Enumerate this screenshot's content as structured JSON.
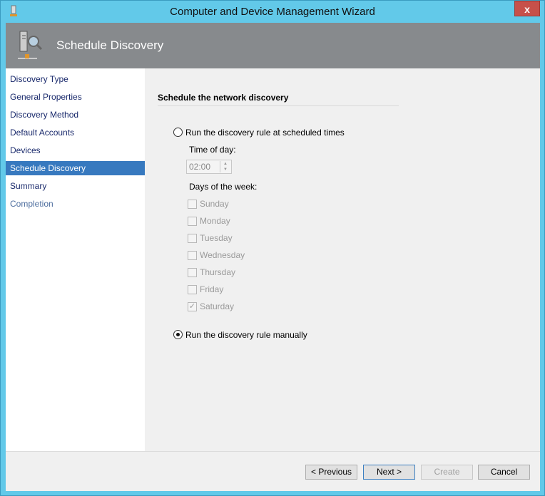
{
  "window": {
    "title": "Computer and Device Management Wizard",
    "close": "x"
  },
  "header": {
    "title": "Schedule Discovery",
    "icon": "server-search-icon"
  },
  "nav": [
    {
      "label": "Discovery Type"
    },
    {
      "label": "General Properties"
    },
    {
      "label": "Discovery Method"
    },
    {
      "label": "Default Accounts"
    },
    {
      "label": "Devices"
    },
    {
      "label": "Schedule Discovery",
      "selected": true
    },
    {
      "label": "Summary"
    },
    {
      "label": "Completion"
    }
  ],
  "main": {
    "section": "Schedule the network discovery",
    "opt_scheduled": "Run the discovery rule at scheduled times",
    "time_label": "Time of day:",
    "time_value": "02:00",
    "days_label": "Days of the week:",
    "days": [
      {
        "label": "Sunday",
        "checked": false
      },
      {
        "label": "Monday",
        "checked": false
      },
      {
        "label": "Tuesday",
        "checked": false
      },
      {
        "label": "Wednesday",
        "checked": false
      },
      {
        "label": "Thursday",
        "checked": false
      },
      {
        "label": "Friday",
        "checked": false
      },
      {
        "label": "Saturday",
        "checked": true
      }
    ],
    "opt_manual": "Run the discovery rule manually",
    "selected_option": "manual"
  },
  "buttons": {
    "previous": "< Previous",
    "next": "Next >",
    "create": "Create",
    "cancel": "Cancel"
  }
}
